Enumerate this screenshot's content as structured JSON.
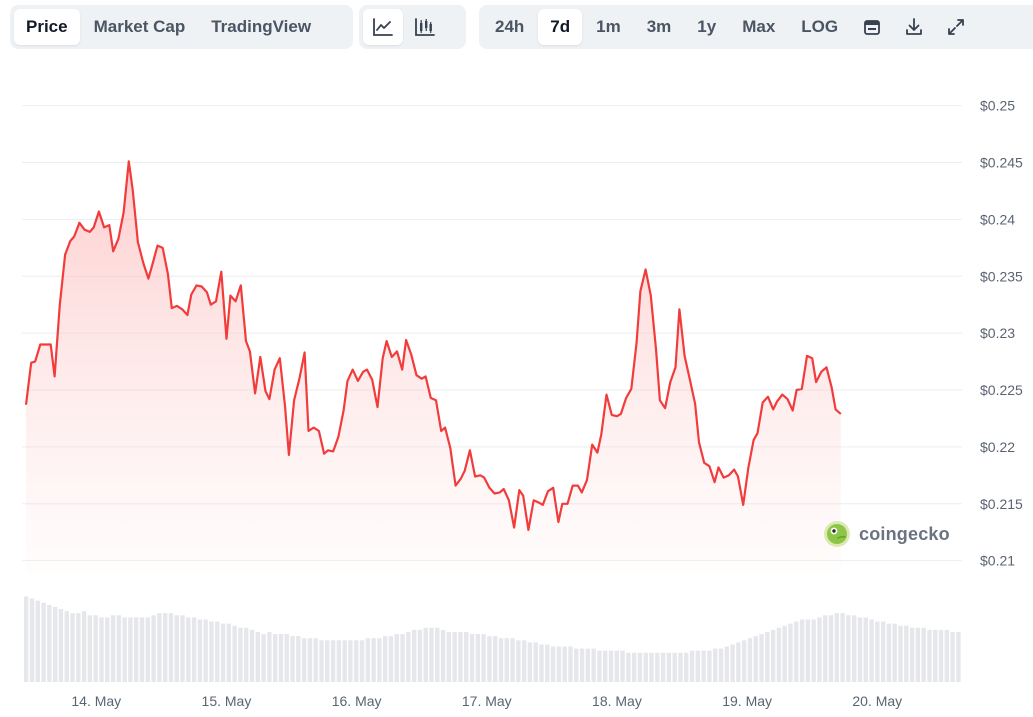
{
  "toolbar": {
    "view_tabs": [
      {
        "label": "Price",
        "active": true
      },
      {
        "label": "Market Cap",
        "active": false
      },
      {
        "label": "TradingView",
        "active": false
      }
    ],
    "chart_type_icons": [
      "line-chart-icon",
      "candlestick-chart-icon"
    ],
    "range_tabs": [
      {
        "label": "24h",
        "active": false
      },
      {
        "label": "7d",
        "active": true
      },
      {
        "label": "1m",
        "active": false
      },
      {
        "label": "3m",
        "active": false
      },
      {
        "label": "1y",
        "active": false
      },
      {
        "label": "Max",
        "active": false
      },
      {
        "label": "LOG",
        "active": false
      }
    ],
    "action_icons": [
      "calendar-icon",
      "download-icon",
      "expand-icon"
    ]
  },
  "watermark": {
    "text": "coingecko"
  },
  "colors": {
    "line": "#f23c3c",
    "fill_top": "#fecaca",
    "volume": "#e5e7eb",
    "grid": "#eceef1",
    "tab_bg": "#eff2f5"
  },
  "chart_data": {
    "type": "line",
    "title": "",
    "xlabel": "",
    "ylabel": "",
    "ylim": [
      0.209,
      0.2505
    ],
    "y_ticks": [
      "$0.21",
      "$0.215",
      "$0.22",
      "$0.225",
      "$0.23",
      "$0.235",
      "$0.24",
      "$0.245",
      "$0.25"
    ],
    "y_tick_values": [
      0.21,
      0.215,
      0.22,
      0.225,
      0.23,
      0.235,
      0.24,
      0.245,
      0.25
    ],
    "x_ticks": [
      "14. May",
      "15. May",
      "16. May",
      "17. May",
      "18. May",
      "19. May",
      "20. May"
    ],
    "x_tick_values": [
      13.76,
      14.76,
      15.76,
      16.76,
      17.76,
      18.76,
      19.76
    ],
    "xlim": [
      13.22,
      20.38
    ],
    "grid": true,
    "series": [
      {
        "values": [
          [
            13.22,
            0.2237
          ],
          [
            13.26,
            0.2274
          ],
          [
            13.29,
            0.2275
          ],
          [
            13.33,
            0.229
          ],
          [
            13.37,
            0.229
          ],
          [
            13.41,
            0.229
          ],
          [
            13.44,
            0.2262
          ],
          [
            13.48,
            0.2325
          ],
          [
            13.52,
            0.2369
          ],
          [
            13.56,
            0.2381
          ],
          [
            13.59,
            0.2385
          ],
          [
            13.63,
            0.2397
          ],
          [
            13.67,
            0.2391
          ],
          [
            13.71,
            0.2389
          ],
          [
            13.74,
            0.2393
          ],
          [
            13.78,
            0.2407
          ],
          [
            13.82,
            0.2393
          ],
          [
            13.86,
            0.2395
          ],
          [
            13.89,
            0.2372
          ],
          [
            13.93,
            0.2383
          ],
          [
            13.97,
            0.2406
          ],
          [
            14.01,
            0.2451
          ],
          [
            14.04,
            0.2426
          ],
          [
            14.08,
            0.238
          ],
          [
            14.12,
            0.2362
          ],
          [
            14.16,
            0.2348
          ],
          [
            14.19,
            0.236
          ],
          [
            14.23,
            0.2377
          ],
          [
            14.27,
            0.2375
          ],
          [
            14.31,
            0.2352
          ],
          [
            14.34,
            0.2322
          ],
          [
            14.38,
            0.2324
          ],
          [
            14.42,
            0.2321
          ],
          [
            14.46,
            0.2316
          ],
          [
            14.49,
            0.2334
          ],
          [
            14.53,
            0.2342
          ],
          [
            14.57,
            0.2341
          ],
          [
            14.61,
            0.2336
          ],
          [
            14.64,
            0.2325
          ],
          [
            14.68,
            0.2328
          ],
          [
            14.72,
            0.2354
          ],
          [
            14.76,
            0.2295
          ],
          [
            14.79,
            0.2333
          ],
          [
            14.83,
            0.2328
          ],
          [
            14.87,
            0.2342
          ],
          [
            14.91,
            0.2293
          ],
          [
            14.94,
            0.2284
          ],
          [
            14.98,
            0.2247
          ],
          [
            15.02,
            0.2279
          ],
          [
            15.06,
            0.2249
          ],
          [
            15.09,
            0.2242
          ],
          [
            15.13,
            0.2268
          ],
          [
            15.17,
            0.2278
          ],
          [
            15.21,
            0.2236
          ],
          [
            15.24,
            0.2193
          ],
          [
            15.28,
            0.2241
          ],
          [
            15.32,
            0.226
          ],
          [
            15.36,
            0.2283
          ],
          [
            15.39,
            0.2214
          ],
          [
            15.43,
            0.2217
          ],
          [
            15.47,
            0.2214
          ],
          [
            15.51,
            0.2194
          ],
          [
            15.54,
            0.2197
          ],
          [
            15.58,
            0.2196
          ],
          [
            15.62,
            0.2209
          ],
          [
            15.66,
            0.2232
          ],
          [
            15.69,
            0.2258
          ],
          [
            15.73,
            0.2268
          ],
          [
            15.77,
            0.2258
          ],
          [
            15.81,
            0.2266
          ],
          [
            15.84,
            0.2268
          ],
          [
            15.88,
            0.2259
          ],
          [
            15.92,
            0.2235
          ],
          [
            15.96,
            0.2278
          ],
          [
            15.99,
            0.2293
          ],
          [
            16.03,
            0.2279
          ],
          [
            16.07,
            0.2284
          ],
          [
            16.11,
            0.2268
          ],
          [
            16.14,
            0.2294
          ],
          [
            16.18,
            0.2281
          ],
          [
            16.22,
            0.2263
          ],
          [
            16.26,
            0.226
          ],
          [
            16.29,
            0.2262
          ],
          [
            16.33,
            0.2243
          ],
          [
            16.37,
            0.2241
          ],
          [
            16.41,
            0.2214
          ],
          [
            16.44,
            0.2217
          ],
          [
            16.48,
            0.2199
          ],
          [
            16.52,
            0.2166
          ],
          [
            16.56,
            0.2172
          ],
          [
            16.59,
            0.2179
          ],
          [
            16.63,
            0.2197
          ],
          [
            16.67,
            0.2174
          ],
          [
            16.71,
            0.2175
          ],
          [
            16.74,
            0.2173
          ],
          [
            16.78,
            0.2164
          ],
          [
            16.82,
            0.2159
          ],
          [
            16.86,
            0.216
          ],
          [
            16.89,
            0.2163
          ],
          [
            16.93,
            0.2153
          ],
          [
            16.97,
            0.2129
          ],
          [
            17.01,
            0.2162
          ],
          [
            17.04,
            0.2157
          ],
          [
            17.08,
            0.2127
          ],
          [
            17.12,
            0.2153
          ],
          [
            17.16,
            0.2151
          ],
          [
            17.19,
            0.2149
          ],
          [
            17.23,
            0.2161
          ],
          [
            17.27,
            0.2164
          ],
          [
            17.31,
            0.2134
          ],
          [
            17.34,
            0.215
          ],
          [
            17.38,
            0.215
          ],
          [
            17.42,
            0.2166
          ],
          [
            17.46,
            0.2166
          ],
          [
            17.49,
            0.216
          ],
          [
            17.53,
            0.2171
          ],
          [
            17.57,
            0.2202
          ],
          [
            17.61,
            0.2195
          ],
          [
            17.64,
            0.2211
          ],
          [
            17.68,
            0.2246
          ],
          [
            17.72,
            0.2228
          ],
          [
            17.76,
            0.2227
          ],
          [
            17.79,
            0.2229
          ],
          [
            17.83,
            0.2243
          ],
          [
            17.87,
            0.2251
          ],
          [
            17.91,
            0.2291
          ],
          [
            17.94,
            0.2337
          ],
          [
            17.98,
            0.2356
          ],
          [
            18.02,
            0.2333
          ],
          [
            18.06,
            0.2286
          ],
          [
            18.09,
            0.2241
          ],
          [
            18.13,
            0.2234
          ],
          [
            18.17,
            0.2257
          ],
          [
            18.21,
            0.227
          ],
          [
            18.24,
            0.2321
          ],
          [
            18.28,
            0.228
          ],
          [
            18.32,
            0.2259
          ],
          [
            18.36,
            0.2238
          ],
          [
            18.39,
            0.2204
          ],
          [
            18.43,
            0.2186
          ],
          [
            18.47,
            0.2183
          ],
          [
            18.51,
            0.2169
          ],
          [
            18.54,
            0.2182
          ],
          [
            18.58,
            0.2173
          ],
          [
            18.62,
            0.2175
          ],
          [
            18.66,
            0.218
          ],
          [
            18.69,
            0.2174
          ],
          [
            18.73,
            0.2149
          ],
          [
            18.77,
            0.2182
          ],
          [
            18.81,
            0.2206
          ],
          [
            18.84,
            0.2212
          ],
          [
            18.88,
            0.2239
          ],
          [
            18.92,
            0.2244
          ],
          [
            18.96,
            0.2233
          ],
          [
            18.99,
            0.224
          ],
          [
            19.03,
            0.2246
          ],
          [
            19.07,
            0.2242
          ],
          [
            19.11,
            0.2232
          ],
          [
            19.14,
            0.225
          ],
          [
            19.18,
            0.2251
          ],
          [
            19.22,
            0.228
          ],
          [
            19.26,
            0.2278
          ],
          [
            19.29,
            0.2257
          ],
          [
            19.33,
            0.2266
          ],
          [
            19.37,
            0.227
          ],
          [
            19.41,
            0.2252
          ],
          [
            19.44,
            0.2233
          ],
          [
            19.48,
            0.2229
          ]
        ]
      }
    ],
    "volume": [
      0.41,
      0.4,
      0.39,
      0.38,
      0.37,
      0.36,
      0.35,
      0.34,
      0.33,
      0.33,
      0.34,
      0.32,
      0.32,
      0.31,
      0.31,
      0.32,
      0.32,
      0.31,
      0.31,
      0.31,
      0.31,
      0.31,
      0.32,
      0.33,
      0.33,
      0.33,
      0.32,
      0.32,
      0.31,
      0.31,
      0.3,
      0.3,
      0.29,
      0.29,
      0.28,
      0.28,
      0.27,
      0.26,
      0.26,
      0.25,
      0.24,
      0.23,
      0.24,
      0.23,
      0.23,
      0.23,
      0.22,
      0.22,
      0.21,
      0.21,
      0.21,
      0.2,
      0.2,
      0.2,
      0.2,
      0.2,
      0.2,
      0.2,
      0.2,
      0.21,
      0.21,
      0.21,
      0.22,
      0.22,
      0.23,
      0.23,
      0.24,
      0.25,
      0.25,
      0.26,
      0.26,
      0.26,
      0.25,
      0.24,
      0.24,
      0.24,
      0.24,
      0.23,
      0.23,
      0.23,
      0.22,
      0.22,
      0.21,
      0.21,
      0.21,
      0.2,
      0.2,
      0.19,
      0.19,
      0.18,
      0.18,
      0.17,
      0.17,
      0.17,
      0.17,
      0.16,
      0.16,
      0.16,
      0.16,
      0.15,
      0.15,
      0.15,
      0.15,
      0.15,
      0.14,
      0.14,
      0.14,
      0.14,
      0.14,
      0.14,
      0.14,
      0.14,
      0.14,
      0.14,
      0.14,
      0.15,
      0.15,
      0.15,
      0.15,
      0.16,
      0.16,
      0.17,
      0.18,
      0.19,
      0.2,
      0.21,
      0.22,
      0.23,
      0.24,
      0.25,
      0.26,
      0.27,
      0.28,
      0.29,
      0.3,
      0.3,
      0.3,
      0.31,
      0.32,
      0.32,
      0.33,
      0.33,
      0.32,
      0.32,
      0.31,
      0.31,
      0.3,
      0.29,
      0.29,
      0.28,
      0.28,
      0.27,
      0.27,
      0.26,
      0.26,
      0.26,
      0.25,
      0.25,
      0.25,
      0.25,
      0.24,
      0.24
    ]
  }
}
